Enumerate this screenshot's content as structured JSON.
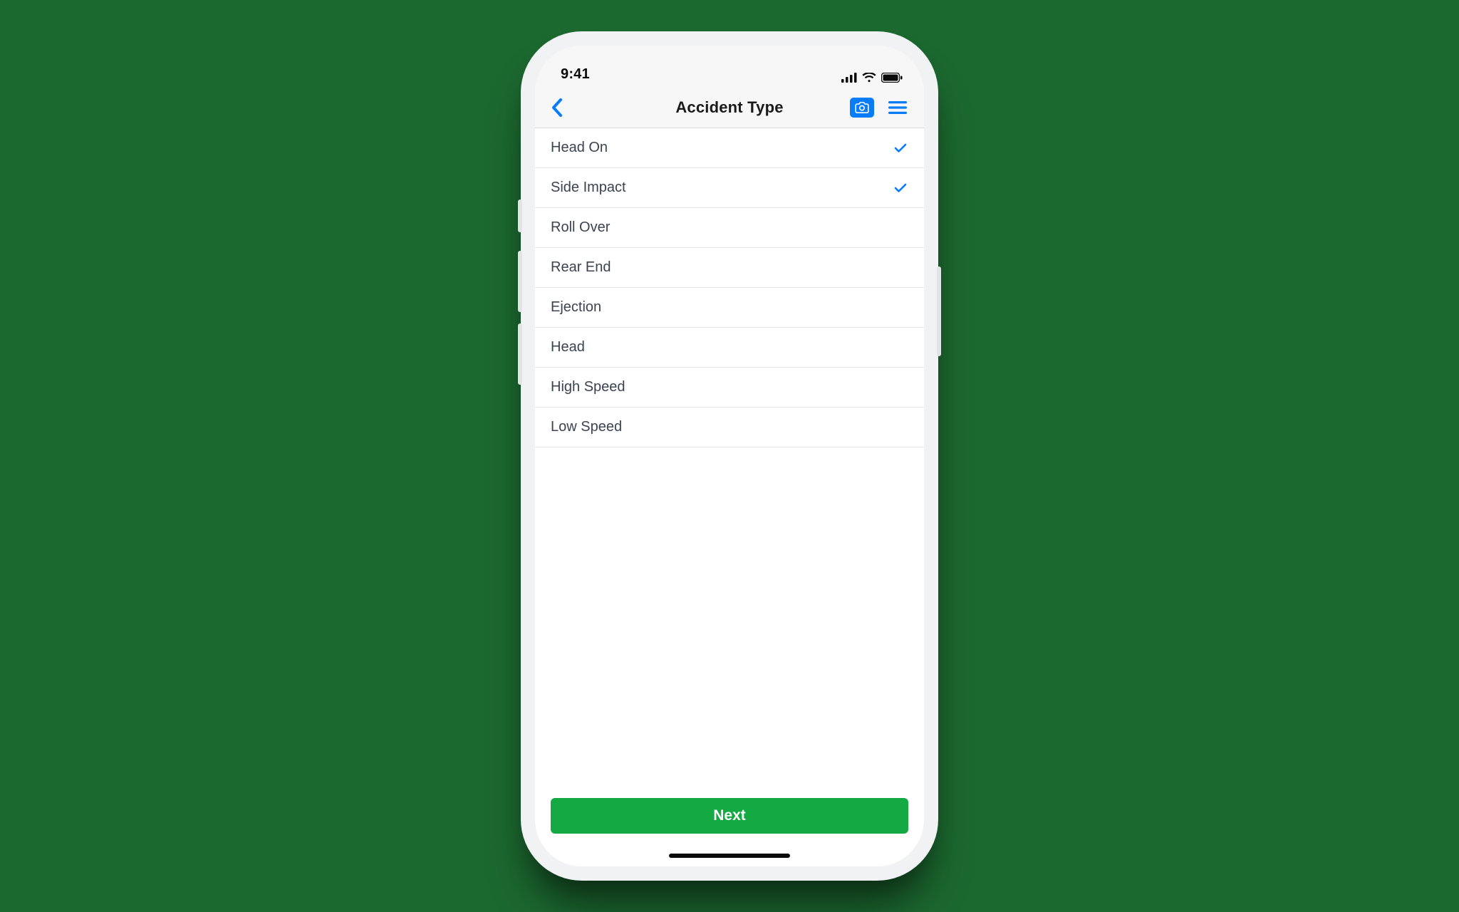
{
  "status_bar": {
    "time": "9:41"
  },
  "navbar": {
    "title": "Accident Type",
    "back_icon": "chevron-left",
    "camera_icon": "camera",
    "menu_icon": "hamburger"
  },
  "list": {
    "items": [
      {
        "label": "Head On",
        "selected": true
      },
      {
        "label": "Side Impact",
        "selected": true
      },
      {
        "label": "Roll Over",
        "selected": false
      },
      {
        "label": "Rear End",
        "selected": false
      },
      {
        "label": "Ejection",
        "selected": false
      },
      {
        "label": "Head",
        "selected": false
      },
      {
        "label": "High Speed",
        "selected": false
      },
      {
        "label": "Low Speed",
        "selected": false
      }
    ]
  },
  "footer": {
    "next_label": "Next"
  },
  "colors": {
    "accent_blue": "#097cf8",
    "primary_green": "#14a942",
    "page_background": "#1c6930"
  }
}
